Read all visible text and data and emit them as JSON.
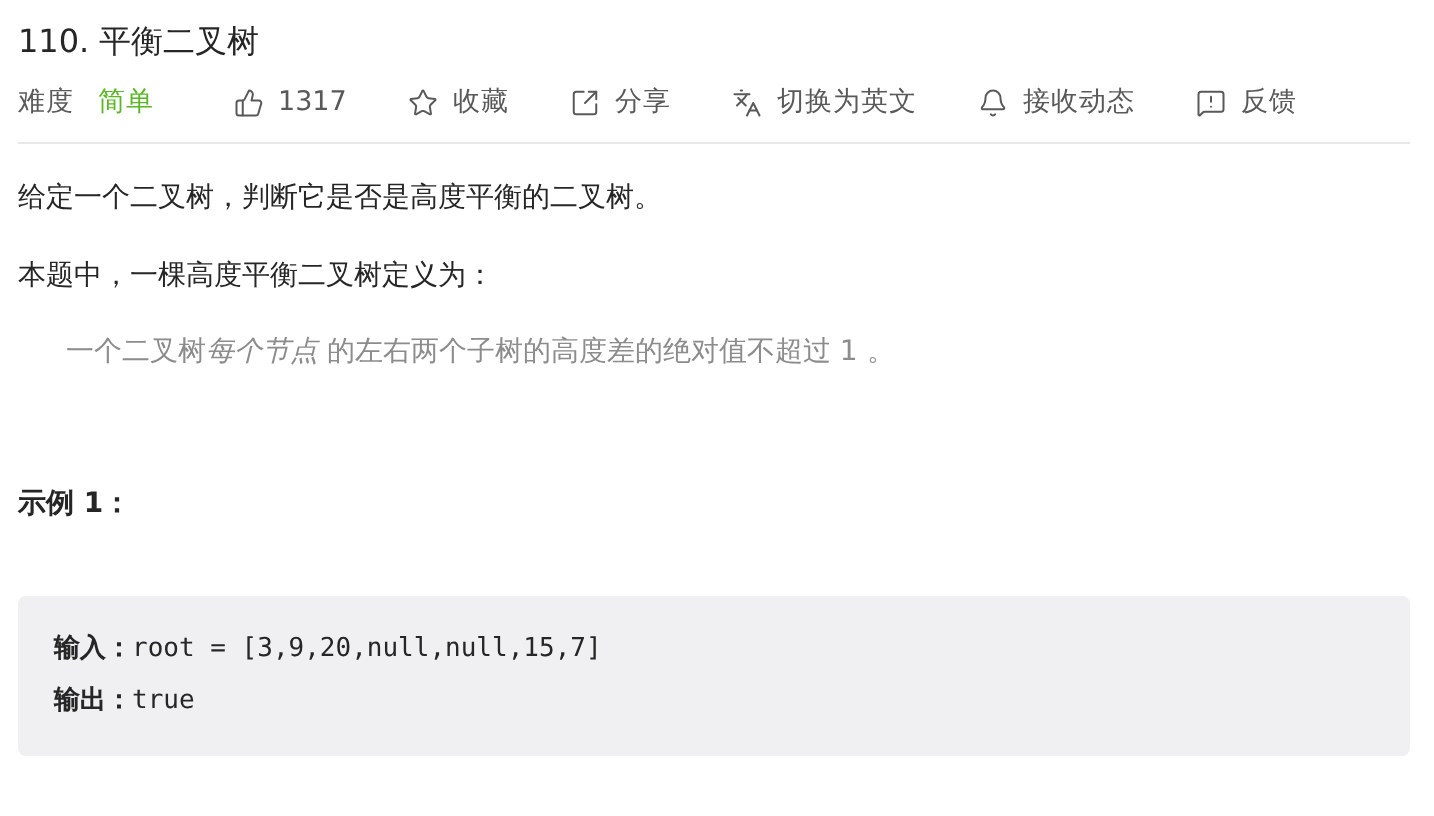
{
  "title": "110. 平衡二叉树",
  "meta": {
    "difficulty_label": "难度",
    "difficulty": "简单"
  },
  "actions": [
    {
      "kind": "like",
      "label": "1317"
    },
    {
      "kind": "star",
      "label": "收藏"
    },
    {
      "kind": "share",
      "label": "分享"
    },
    {
      "kind": "translate",
      "label": "切换为英文"
    },
    {
      "kind": "bell",
      "label": "接收动态"
    },
    {
      "kind": "feedback",
      "label": "反馈"
    }
  ],
  "paragraphs": [
    "给定一个二叉树，判断它是否是高度平衡的二叉树。",
    "本题中，一棵高度平衡二叉树定义为："
  ],
  "quote": [
    {
      "text": "一个二叉树",
      "italic": false
    },
    {
      "text": "每个节点",
      "italic": true
    },
    {
      "text": " 的左右两个子树的高度差的绝对值不超过 1 。",
      "italic": false
    }
  ],
  "example_heading": "示例 1：",
  "example_lines": [
    "**输入：**root = [3,9,20,null,null,15,7]",
    "**输出：**true"
  ]
}
